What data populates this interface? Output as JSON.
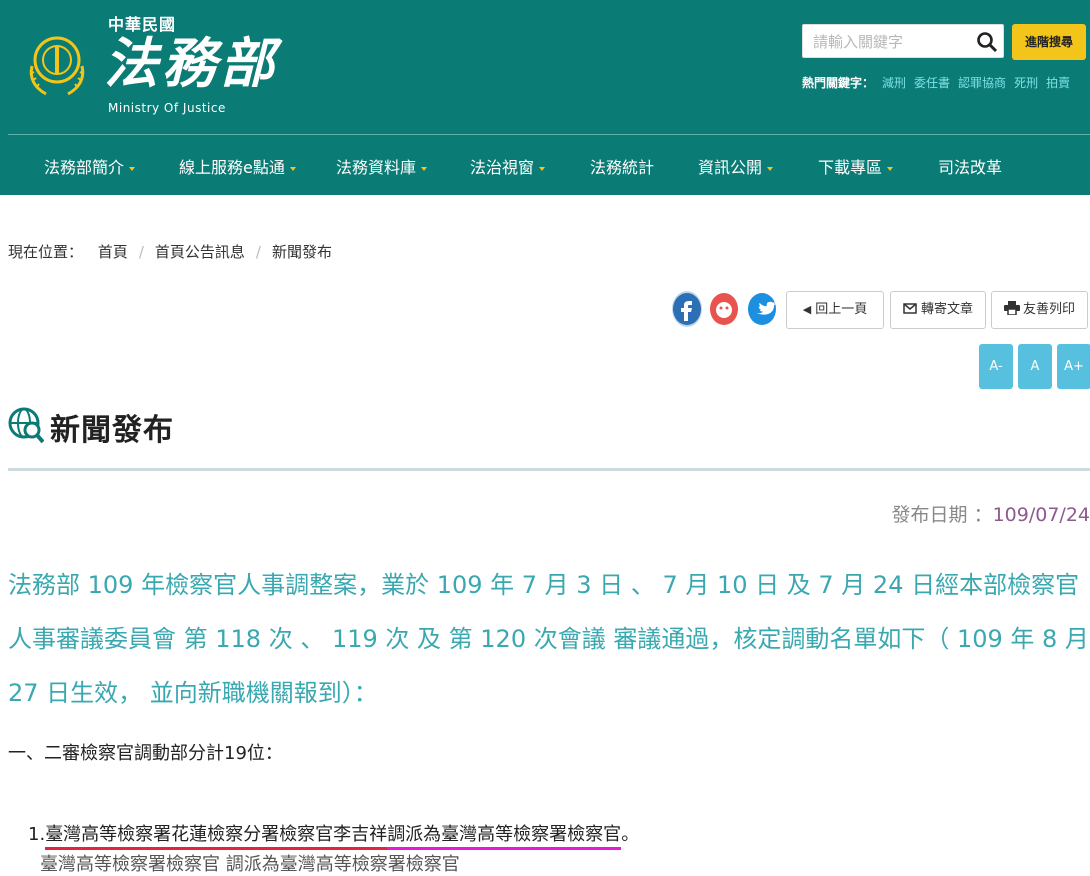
{
  "header": {
    "roc_label": "中華民國",
    "logo_text": "法務部",
    "logo_en": "Ministry Of Justice",
    "search_placeholder": "請輸入關鍵字",
    "advanced_search": "進階搜尋",
    "hot_label": "熱門關鍵字：",
    "hot_keywords": [
      "減刑",
      "委任書",
      "認罪協商",
      "死刑",
      "拍賣"
    ]
  },
  "nav": [
    "法務部簡介",
    "線上服務e點通",
    "法務資料庫",
    "法治視窗",
    "法務統計",
    "資訊公開",
    "下載專區",
    "司法改革"
  ],
  "breadcrumb": {
    "prefix": "現在位置：",
    "items": [
      "首頁",
      "首頁公告訊息",
      "新聞發布"
    ]
  },
  "tools": {
    "back": "回上一頁",
    "forward": "轉寄文章",
    "print": "友善列印",
    "font_small": "A-",
    "font_normal": "A",
    "font_large": "A+"
  },
  "page_title": "新聞發布",
  "date_label": "發布日期 ：",
  "date_value": "109/07/24",
  "intro": "法務部 109 年檢察官人事調整案，業於 109 年 7 月 3 日 、 7 月 10 日 及 7 月 24 日經本部檢察官人事審議委員會 第 118 次 、 119 次 及 第 120 次會議 審議通過，核定調動名單如下（ 109 年 8 月 27 日生效， 並向新職機關報到）：",
  "section1": "一、二審檢察官調動部分計19位：",
  "item1": {
    "number": "1.",
    "part_a": "臺灣高等檢察署花蓮檢察分署檢察官李吉祥",
    "part_b": "調派為臺灣高等檢察署檢察官",
    "end": "。"
  },
  "item2_partial": "臺灣高等檢察署檢察官 調派為臺灣高等檢察署檢察官",
  "colors": {
    "header_bg": "#0b7b75",
    "accent_yellow": "#f3c51a",
    "intro_text": "#3aa8b0",
    "font_btn": "#56c0de"
  }
}
